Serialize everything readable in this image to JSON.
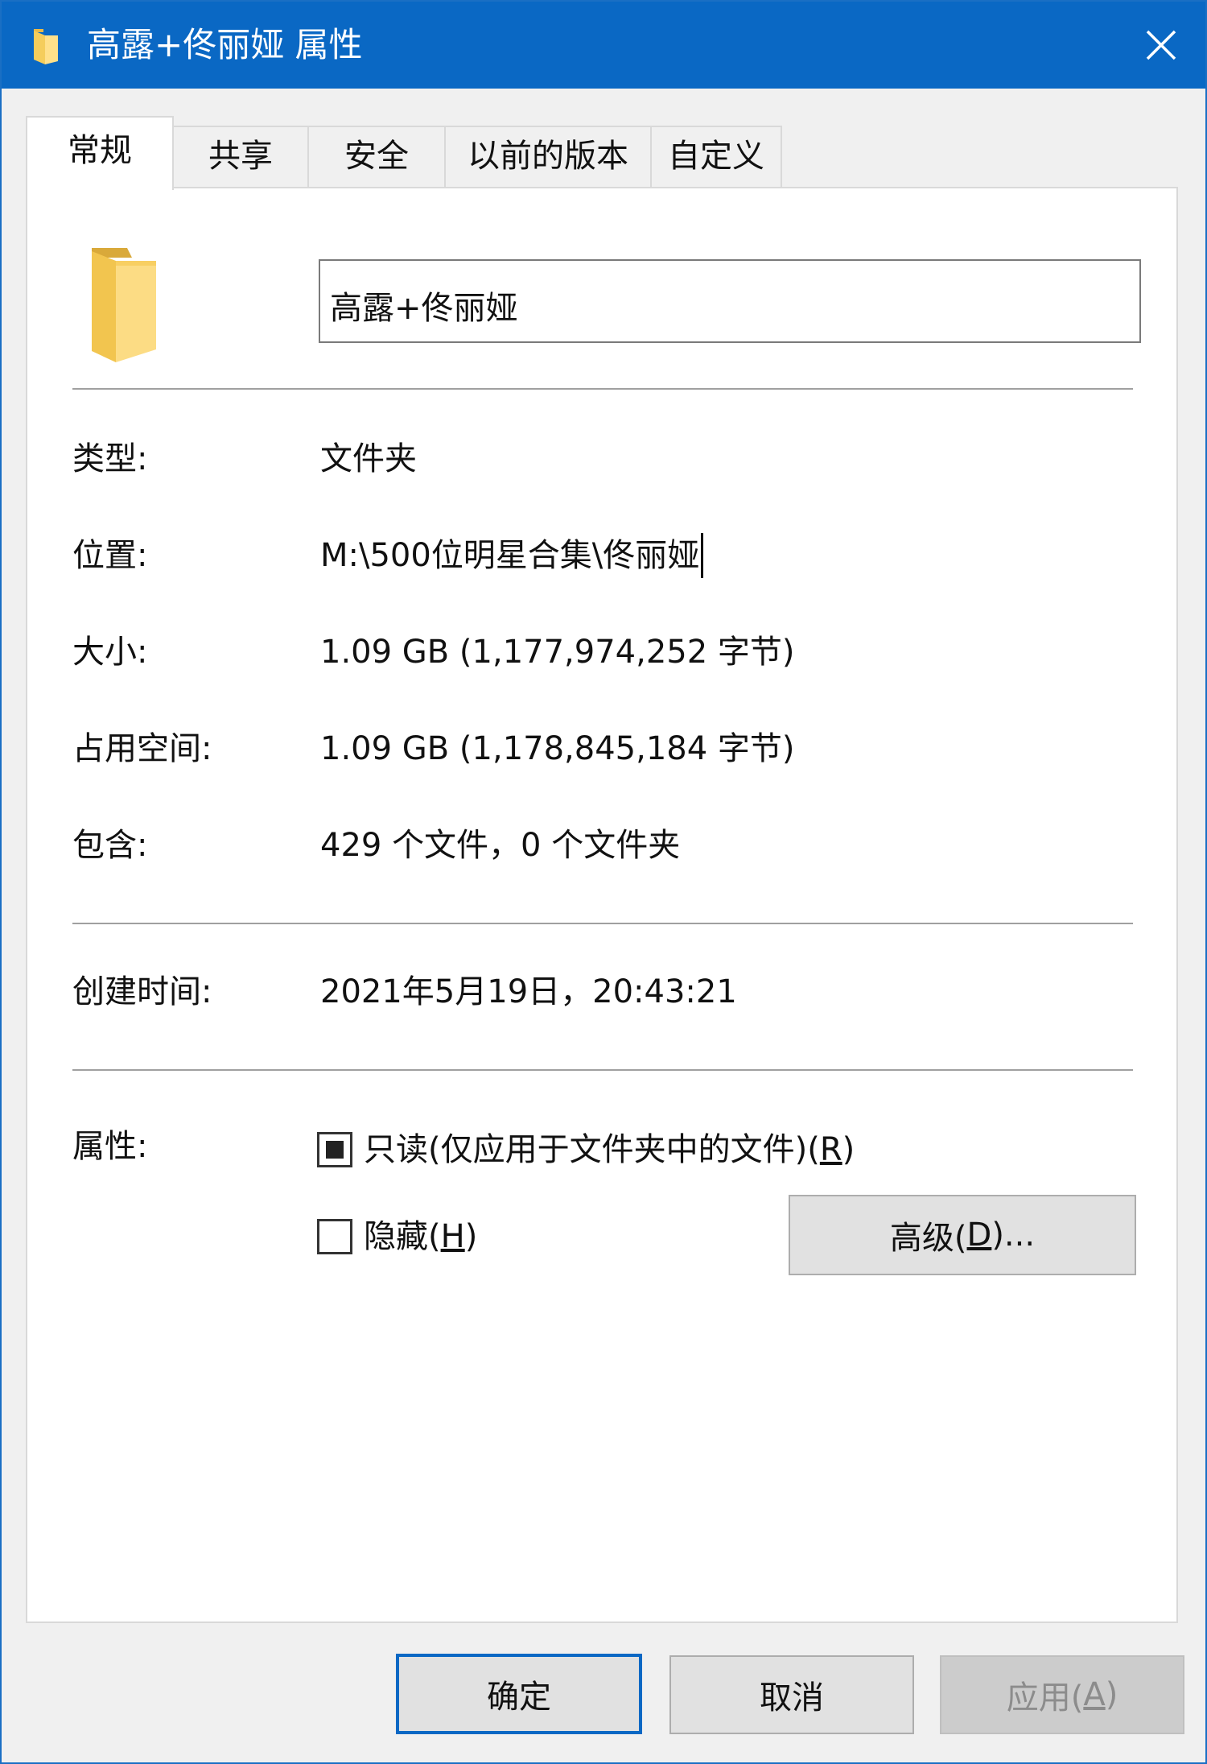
{
  "window": {
    "title": "高露+佟丽娅 属性",
    "accent_color": "#0a68c4"
  },
  "tabs": [
    {
      "label": "常规",
      "active": true
    },
    {
      "label": "共享",
      "active": false
    },
    {
      "label": "安全",
      "active": false
    },
    {
      "label": "以前的版本",
      "active": false
    },
    {
      "label": "自定义",
      "active": false
    }
  ],
  "general": {
    "folder_name": "高露+佟丽娅",
    "type_label": "类型:",
    "type_value": "文件夹",
    "location_label": "位置:",
    "location_value": "M:\\500位明星合集\\佟丽娅",
    "size_label": "大小:",
    "size_value": "1.09 GB (1,177,974,252 字节)",
    "disk_size_label": "占用空间:",
    "disk_size_value": "1.09 GB (1,178,845,184 字节)",
    "contains_label": "包含:",
    "contains_value": "429 个文件，0 个文件夹",
    "created_label": "创建时间:",
    "created_value": "2021年5月19日，20:43:21",
    "attributes_label": "属性:",
    "readonly_label_prefix": "只读(仅应用于文件夹中的文件)(",
    "readonly_accel": "R",
    "readonly_label_suffix": ")",
    "readonly_state": "indeterminate",
    "hidden_label_prefix": "隐藏(",
    "hidden_accel": "H",
    "hidden_label_suffix": ")",
    "hidden_state": "unchecked",
    "advanced_prefix": "高级(",
    "advanced_accel": "D",
    "advanced_suffix": ")..."
  },
  "footer": {
    "ok": "确定",
    "cancel": "取消",
    "apply_prefix": "应用(",
    "apply_accel": "A",
    "apply_suffix": ")"
  },
  "icons": {
    "title": "folder-icon",
    "close": "close-icon",
    "folder": "folder-icon"
  }
}
